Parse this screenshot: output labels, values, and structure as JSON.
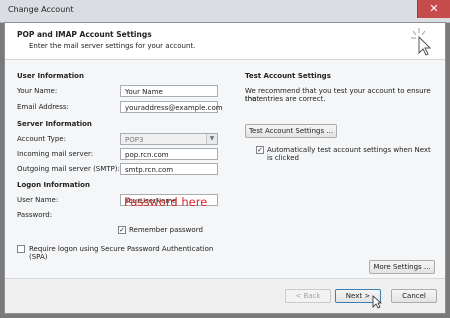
{
  "window": {
    "title": "Change Account",
    "close_glyph": "✕"
  },
  "header": {
    "title": "POP and IMAP Account Settings",
    "subtitle": "Enter the mail server settings for your account.",
    "icon": "cursor-sparkle-icon"
  },
  "user_info": {
    "section": "User Information",
    "name_label": "Your Name:",
    "name_value": "Your Name",
    "email_label": "Email Address:",
    "email_value": "youraddress@example.com"
  },
  "server_info": {
    "section": "Server Information",
    "type_label": "Account Type:",
    "type_value": "POP3",
    "incoming_label": "Incoming mail server:",
    "incoming_value": "pop.rcn.com",
    "outgoing_label": "Outgoing mail server (SMTP):",
    "outgoing_value": "smtp.rcn.com"
  },
  "logon_info": {
    "section": "Logon Information",
    "user_label": "User Name:",
    "user_value": "YourUserName",
    "password_label": "Password:",
    "password_note": "Password here",
    "remember_label": "Remember password",
    "remember_checked": true,
    "spa_label_line1": "Require logon using Secure Password Authentication",
    "spa_label_line2": "(SPA)",
    "spa_checked": false
  },
  "test": {
    "section": "Test Account Settings",
    "desc_line1": "We recommend that you test your account to ensure that",
    "desc_line2": "the entries are correct.",
    "button": "Test Account Settings ...",
    "auto_label_line1": "Automatically test account settings when Next",
    "auto_label_line2": "is clicked",
    "auto_checked": true
  },
  "buttons": {
    "more": "More Settings ...",
    "back": "< Back",
    "next": "Next >",
    "cancel": "Cancel"
  },
  "colors": {
    "annotation": "#d22b2b",
    "accent": "#3c7fb1"
  }
}
